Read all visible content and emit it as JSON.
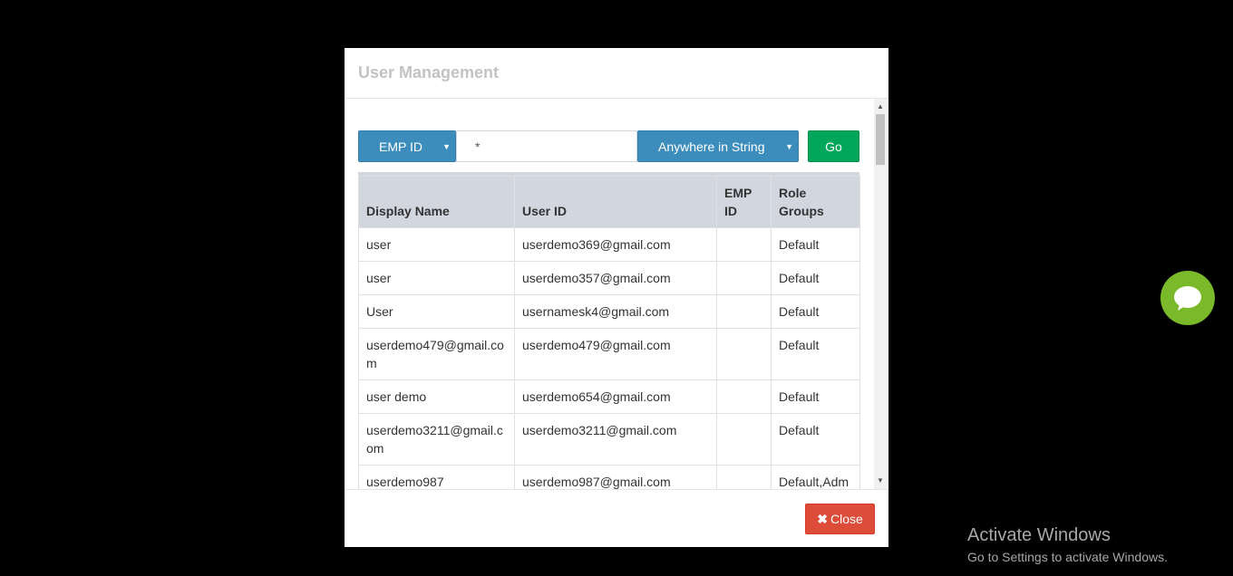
{
  "modal": {
    "title": "User Management",
    "search": {
      "field_label": "EMP ID",
      "input_value": "*",
      "match_label": "Anywhere in String",
      "go_label": "Go"
    },
    "table": {
      "headers": [
        "Display Name",
        "User ID",
        "EMP ID",
        "Role Groups"
      ],
      "rows": [
        [
          "user",
          "userdemo369@gmail.com",
          "",
          "Default"
        ],
        [
          "user",
          "userdemo357@gmail.com",
          "",
          "Default"
        ],
        [
          "User",
          "usernamesk4@gmail.com",
          "",
          "Default"
        ],
        [
          "userdemo479@gmail.com",
          "userdemo479@gmail.com",
          "",
          "Default"
        ],
        [
          "user demo",
          "userdemo654@gmail.com",
          "",
          "Default"
        ],
        [
          "userdemo3211@gmail.com",
          "userdemo3211@gmail.com",
          "",
          "Default"
        ],
        [
          "userdemo987",
          "userdemo987@gmail.com",
          "",
          "Default,Adm"
        ]
      ]
    },
    "close_label": "Close"
  },
  "watermark": {
    "title": "Activate Windows",
    "subtitle": "Go to Settings to activate Windows."
  },
  "colors": {
    "primary": "#3c8dbc",
    "success": "#00a65a",
    "danger": "#dd4b39",
    "chat": "#7ab929"
  }
}
